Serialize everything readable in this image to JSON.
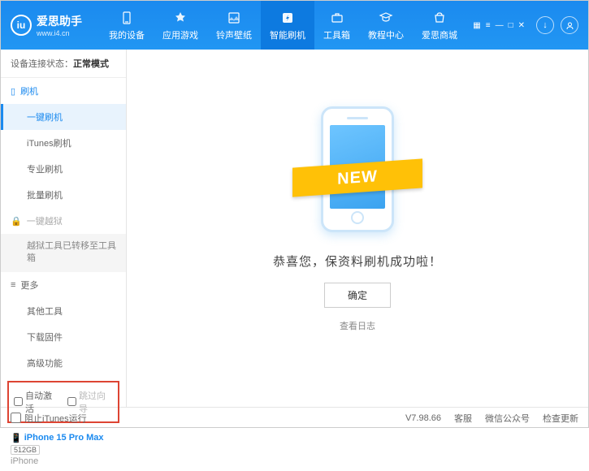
{
  "logo": {
    "icon": "iu",
    "main": "爱思助手",
    "sub": "www.i4.cn"
  },
  "nav": [
    {
      "label": "我的设备"
    },
    {
      "label": "应用游戏"
    },
    {
      "label": "铃声壁纸"
    },
    {
      "label": "智能刷机",
      "active": true
    },
    {
      "label": "工具箱"
    },
    {
      "label": "教程中心"
    },
    {
      "label": "爱思商城"
    }
  ],
  "status": {
    "label": "设备连接状态：",
    "value": "正常模式"
  },
  "sections": {
    "flash": {
      "title": "刷机",
      "items": [
        "一键刷机",
        "iTunes刷机",
        "专业刷机",
        "批量刷机"
      ]
    },
    "jailbreak": {
      "title": "一键越狱",
      "note": "越狱工具已转移至工具箱"
    },
    "more": {
      "title": "更多",
      "items": [
        "其他工具",
        "下载固件",
        "高级功能"
      ]
    }
  },
  "options": {
    "autoActivate": "自动激活",
    "skipGuide": "跳过向导"
  },
  "device": {
    "name": "iPhone 15 Pro Max",
    "storage": "512GB",
    "model": "iPhone"
  },
  "main": {
    "ribbon": "NEW",
    "success": "恭喜您，保资料刷机成功啦！",
    "ok": "确定",
    "log": "查看日志"
  },
  "footer": {
    "block": "阻止iTunes运行",
    "version": "V7.98.66",
    "links": [
      "客服",
      "微信公众号",
      "检查更新"
    ]
  }
}
